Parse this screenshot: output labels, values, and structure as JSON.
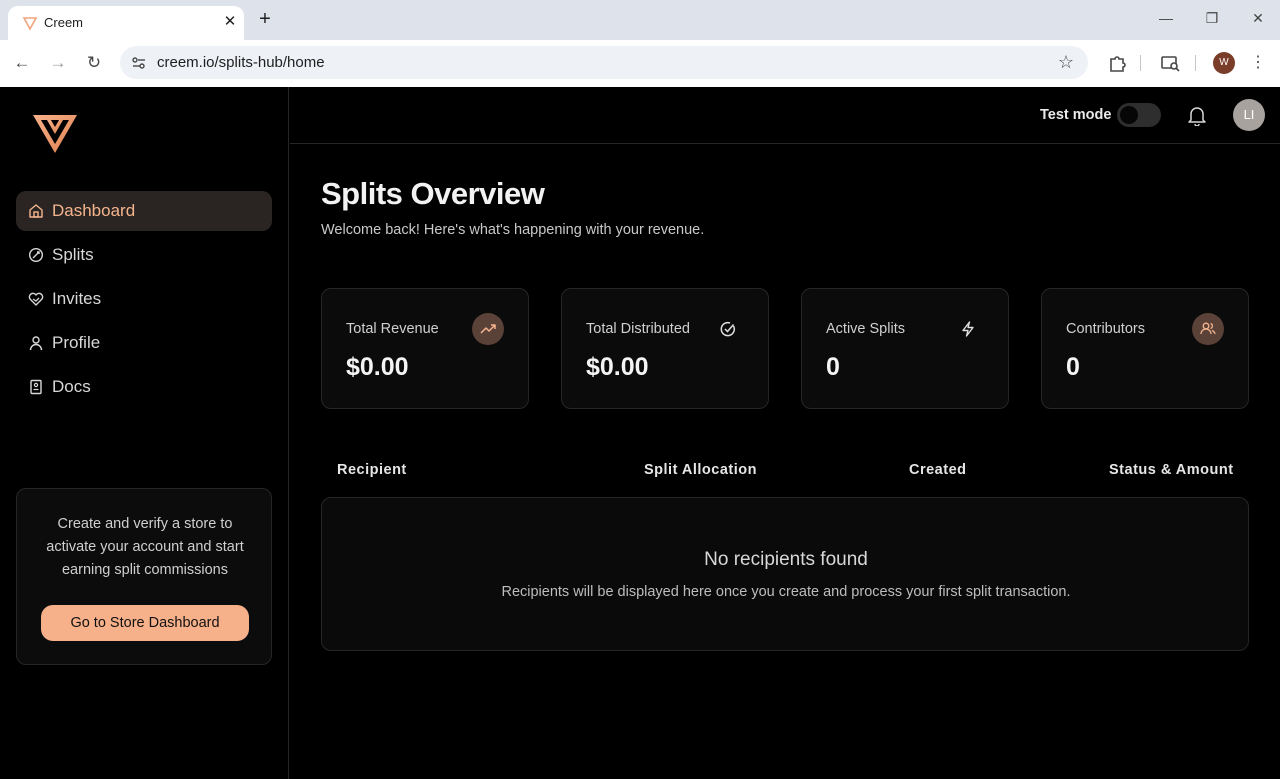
{
  "browser": {
    "tab_title": "Creem",
    "url": "creem.io/splits-hub/home",
    "profile_initial": "W"
  },
  "sidebar": {
    "items": [
      {
        "label": "Dashboard",
        "icon": "home-icon",
        "active": true
      },
      {
        "label": "Splits",
        "icon": "splits-icon",
        "active": false
      },
      {
        "label": "Invites",
        "icon": "invites-icon",
        "active": false
      },
      {
        "label": "Profile",
        "icon": "user-icon",
        "active": false
      },
      {
        "label": "Docs",
        "icon": "book-icon",
        "active": false
      }
    ],
    "promo": {
      "text": "Create and verify a store to activate your account and start earning split commissions",
      "button_label": "Go to Store Dashboard"
    }
  },
  "topbar": {
    "test_mode_label": "Test mode",
    "test_mode_on": false,
    "avatar_initials": "LI"
  },
  "main": {
    "title": "Splits Overview",
    "subtitle": "Welcome back! Here's what's happening with your revenue.",
    "cards": [
      {
        "label": "Total Revenue",
        "value": "$0.00",
        "icon": "trending-up-icon"
      },
      {
        "label": "Total Distributed",
        "value": "$0.00",
        "icon": "check-circle-icon"
      },
      {
        "label": "Active Splits",
        "value": "0",
        "icon": "lightning-icon"
      },
      {
        "label": "Contributors",
        "value": "0",
        "icon": "users-icon"
      }
    ],
    "table": {
      "headers": [
        "Recipient",
        "Split Allocation",
        "Created",
        "Status & Amount"
      ],
      "empty_title": "No recipients found",
      "empty_text": "Recipients will be displayed here once you create and process your first split transaction."
    }
  },
  "colors": {
    "accent": "#f7b18a",
    "background": "#000000",
    "card_border": "#262626"
  }
}
